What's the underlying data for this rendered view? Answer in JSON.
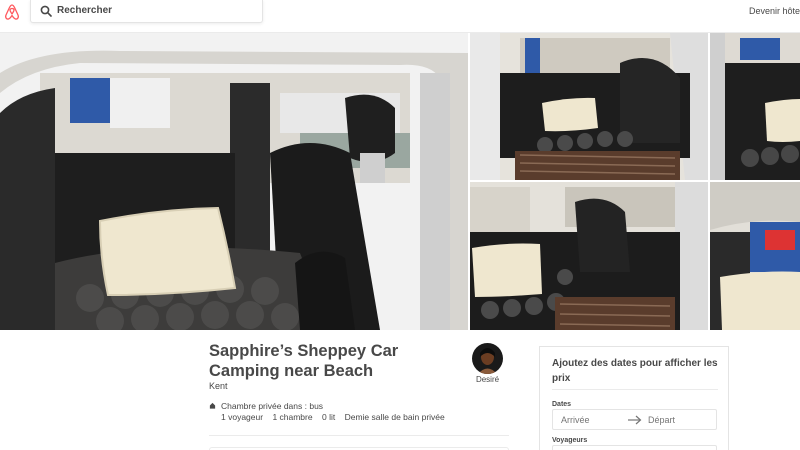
{
  "header": {
    "logo_icon": "airbnb-logo-icon",
    "search_placeholder": "Rechercher",
    "host_link": "Devenir hôte"
  },
  "colors": {
    "brand": "#FF5A5F",
    "text": "#484848",
    "border": "#EBEBEB"
  },
  "gallery": {
    "photos": [
      {
        "icon": "car-interior-photo"
      },
      {
        "icon": "car-interior-photo"
      },
      {
        "icon": "car-interior-photo"
      },
      {
        "icon": "car-interior-photo"
      },
      {
        "icon": "car-interior-photo"
      }
    ]
  },
  "listing": {
    "title": "Sapphire’s Sheppey Car Camping near Beach",
    "city": "Kent",
    "room_type": "Chambre privée dans : bus",
    "facts": [
      "1 voyageur",
      "1 chambre",
      "0 lit",
      "Demie salle de bain privée"
    ]
  },
  "host": {
    "name": "Desiré",
    "avatar_icon": "host-avatar"
  },
  "booking": {
    "prompt": "Ajoutez des dates pour afficher les prix",
    "dates_label": "Dates",
    "checkin_placeholder": "Arrivée",
    "checkout_placeholder": "Départ",
    "guests_label": "Voyageurs"
  }
}
